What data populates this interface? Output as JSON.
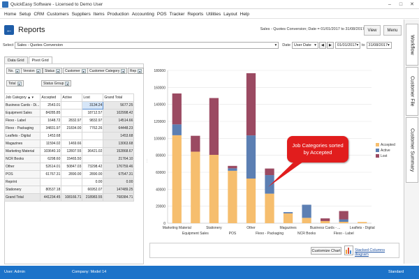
{
  "window": {
    "title": "QuickEasy Software - Licensed to Demo User",
    "minimize": "–",
    "maximize": "□",
    "close": "✕"
  },
  "menu": [
    "Home",
    "Setup",
    "CRM",
    "Customers",
    "Suppliers",
    "Items",
    "Production",
    "Accounting",
    "POS",
    "Tracker",
    "Reports",
    "Utilities",
    "Layout",
    "Help"
  ],
  "toolbar": {
    "title": "Reports",
    "report_info": "Sales - Quotes Conversion; Date = 01/01/2017 to 31/08/2017",
    "view_label": "View",
    "menu_label": "Menu"
  },
  "select_row": {
    "select_label": "Select",
    "report_value": "Sales - Quotes Conversion",
    "date_label": "Date",
    "date_mode": "User Date",
    "date_from": "01/01/2017",
    "to_label": "to",
    "date_to": "31/08/2017"
  },
  "tabs": [
    "Data Grid",
    "Pivot Grid"
  ],
  "filter_fields": [
    "No.",
    "Version",
    "Status",
    "Customer",
    "Customer Category",
    "Rep"
  ],
  "data_field": "Total",
  "column_field": "Status Group",
  "grid": {
    "row_header": "Job Category",
    "columns": [
      "Accepted",
      "Active",
      "Lost",
      "Grand Total"
    ],
    "rows": [
      {
        "label": "Business Cards - Di...",
        "values": [
          "2543.01",
          "",
          "3134.24",
          "5677.25"
        ]
      },
      {
        "label": "Equipment Sales",
        "values": [
          "84285.85",
          "",
          "18712.57",
          "102998.42"
        ]
      },
      {
        "label": "Flexo - Label",
        "values": [
          "1648.72",
          "2832.97",
          "9832.97",
          "14514.66"
        ]
      },
      {
        "label": "Flexo - Packaging",
        "values": [
          "34831.97",
          "21834.00",
          "7762.26",
          "64448.23"
        ]
      },
      {
        "label": "Leaflets - Digital",
        "values": [
          "1453.68",
          "",
          "",
          "1453.68"
        ]
      },
      {
        "label": "Magazines",
        "values": [
          "11594.02",
          "1469.66",
          "",
          "13063.68"
        ]
      },
      {
        "label": "Marketing Material",
        "values": [
          "103640.10",
          "12807.55",
          "36421.02",
          "152868.67"
        ]
      },
      {
        "label": "NCR Books",
        "values": [
          "6298.60",
          "15465.50",
          "",
          "21764.10"
        ]
      },
      {
        "label": "Other",
        "values": [
          "52614.01",
          "50847.03",
          "73298.42",
          "176759.46"
        ]
      },
      {
        "label": "POS",
        "values": [
          "61767.31",
          "2890.00",
          "2890.00",
          "67547.31"
        ]
      },
      {
        "label": "Reprint",
        "values": [
          "",
          "",
          "0.00",
          "0.00"
        ]
      },
      {
        "label": "Stationery",
        "values": [
          "80537.18",
          "",
          "66952.07",
          "147489.25"
        ]
      }
    ],
    "total": {
      "label": "Grand Total",
      "values": [
        "441234.45",
        "108166.71",
        "218983.55",
        "768384.71"
      ]
    }
  },
  "chart_data": {
    "type": "bar",
    "stacked": true,
    "categories": [
      "Marketing Material",
      "Equipment Sales",
      "Stationery",
      "POS",
      "Other",
      "Flexo - Packaging",
      "Magazines",
      "NCR Books",
      "Business Cards - ...",
      "Flexo - Label",
      "Leaflets - Digital"
    ],
    "series": [
      {
        "name": "Accepted",
        "color": "#F6BE6E",
        "values": [
          103640.1,
          84285.85,
          80537.18,
          61767.31,
          52614.01,
          34831.97,
          11594.02,
          6298.6,
          2543.01,
          1648.72,
          1453.68
        ]
      },
      {
        "name": "Active",
        "color": "#5C7FB3",
        "values": [
          12807.55,
          0,
          0,
          2890.0,
          50847.03,
          21834.0,
          1469.66,
          15465.5,
          0,
          2832.97,
          0
        ]
      },
      {
        "name": "Lost",
        "color": "#9B4A62",
        "values": [
          36421.02,
          18712.57,
          66952.07,
          2890.0,
          73298.42,
          7762.26,
          0,
          0,
          3134.24,
          9832.97,
          0
        ]
      }
    ],
    "yticks": [
      "0",
      "20000",
      "40000",
      "60000",
      "80000",
      "100000",
      "120000",
      "140000",
      "160000",
      "180000"
    ],
    "ylim": [
      0,
      180000
    ],
    "legend": "right",
    "grid": true
  },
  "callout": {
    "line1": "Job Categories sorted",
    "line2": "by Accepted"
  },
  "bottom": {
    "customize_label": "Customize Chart",
    "diagram_label": "Stacked Columns diagram"
  },
  "side_tabs": [
    "Workflow",
    "Customer File",
    "Customer Summary"
  ],
  "status": {
    "user": "User: Admin",
    "company": "Company: Model 14",
    "mode": "Standard"
  }
}
